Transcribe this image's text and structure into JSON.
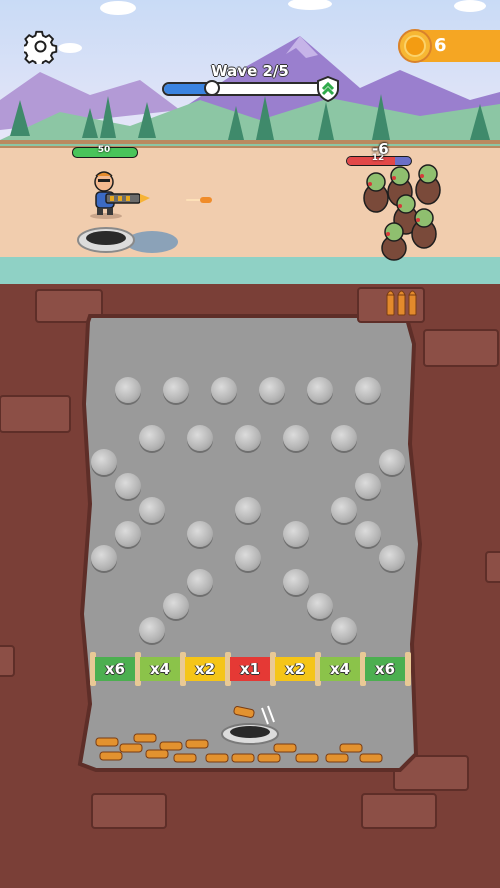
{
  "hud": {
    "settings_icon": "gear-icon",
    "coins": "6",
    "coin_icon": "coin-icon"
  },
  "wave": {
    "label": "Wave 2/5",
    "progress": 0.3,
    "end_icon": "shield-chevron-icon"
  },
  "battle": {
    "hero_hp": "50",
    "hero_hp_fraction": 1.0,
    "enemy_hp": "12",
    "enemy_hp_fraction": 0.75,
    "damage_popup": "-6"
  },
  "board": {
    "multipliers": [
      {
        "label": "x6",
        "color": "#4caf50"
      },
      {
        "label": "x4",
        "color": "#8bc34a"
      },
      {
        "label": "x2",
        "color": "#f5c518"
      },
      {
        "label": "x1",
        "color": "#e53935"
      },
      {
        "label": "x2",
        "color": "#f5c518"
      },
      {
        "label": "x4",
        "color": "#8bc34a"
      },
      {
        "label": "x6",
        "color": "#4caf50"
      }
    ]
  },
  "colors": {
    "coin": "#f5a623",
    "dirt": "#7a3f37",
    "board": "#9a9a9a"
  }
}
